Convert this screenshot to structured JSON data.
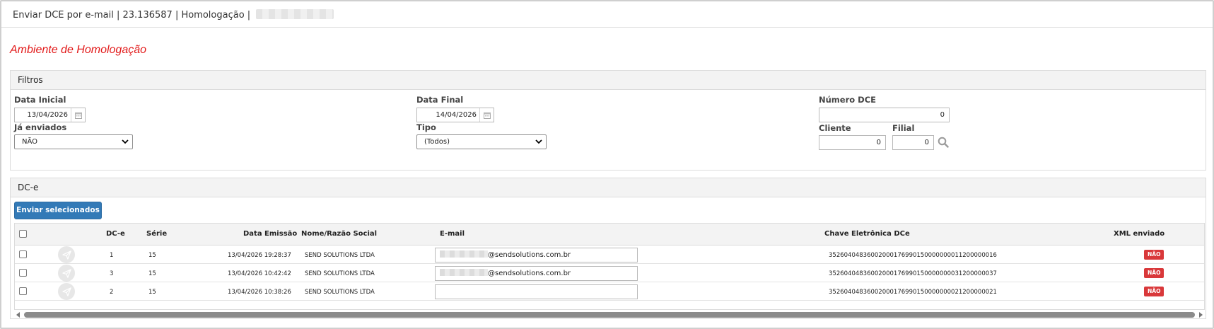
{
  "window": {
    "title": "Enviar DCE por e-mail | 23.136587 | Homologação |"
  },
  "environment_label": "Ambiente de Homologação",
  "filters": {
    "title": "Filtros",
    "data_inicial": {
      "label": "Data Inicial",
      "value": "13/04/2026"
    },
    "data_final": {
      "label": "Data Final",
      "value": "14/04/2026"
    },
    "numero_dce": {
      "label": "Número DCE",
      "value": "0"
    },
    "ja_enviados": {
      "label": "Já enviados",
      "value": "NÃO"
    },
    "tipo": {
      "label": "Tipo",
      "value": "(Todos)"
    },
    "cliente": {
      "label": "Cliente",
      "value": "0"
    },
    "filial": {
      "label": "Filial",
      "value": "0"
    }
  },
  "dce_panel": {
    "title": "DC-e",
    "send_button": "Enviar selecionados",
    "columns": {
      "dce": "DC-e",
      "serie": "Série",
      "data_emissao": "Data Emissão",
      "nome": "Nome/Razão Social",
      "email": "E-mail",
      "chave": "Chave Eletrônica DCe",
      "xml": "XML enviado"
    },
    "rows": [
      {
        "dce": "1",
        "serie": "15",
        "data_emissao": "13/04/2026 19:28:37",
        "nome": "SEND SOLUTIONS LTDA",
        "email_domain": "@sendsolutions.com.br",
        "chave": "35260404836002000176990150000000011200000016",
        "xml": "NÃO"
      },
      {
        "dce": "3",
        "serie": "15",
        "data_emissao": "13/04/2026 10:42:42",
        "nome": "SEND SOLUTIONS LTDA",
        "email_domain": "@sendsolutions.com.br",
        "chave": "35260404836002000176990150000000031200000037",
        "xml": "NÃO"
      },
      {
        "dce": "2",
        "serie": "15",
        "data_emissao": "13/04/2026 10:38:26",
        "nome": "SEND SOLUTIONS LTDA",
        "email_domain": "",
        "chave": "35260404836002000176990150000000021200000021",
        "xml": "NÃO"
      }
    ]
  },
  "colors": {
    "env_red": "#e21a1a",
    "primary": "#337ab7",
    "badge_red": "#d9383a"
  }
}
